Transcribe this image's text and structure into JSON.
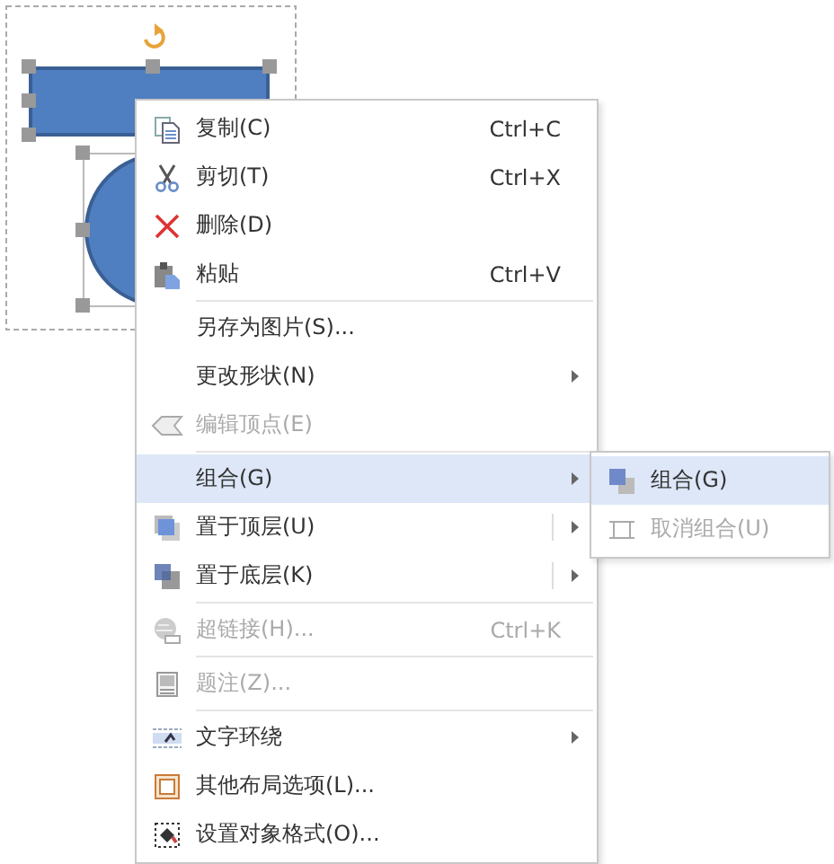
{
  "menu": {
    "items": [
      {
        "label": "复制(C)",
        "shortcut": "Ctrl+C",
        "disabled": false,
        "selected": false,
        "submenu": false,
        "split": false,
        "separator_before": false
      },
      {
        "label": "剪切(T)",
        "shortcut": "Ctrl+X",
        "disabled": false,
        "selected": false,
        "submenu": false,
        "split": false,
        "separator_before": false
      },
      {
        "label": "删除(D)",
        "disabled": false,
        "selected": false,
        "submenu": false,
        "split": false,
        "separator_before": false
      },
      {
        "label": "粘贴",
        "shortcut": "Ctrl+V",
        "disabled": false,
        "selected": false,
        "submenu": false,
        "split": false,
        "separator_before": false
      },
      {
        "label": "另存为图片(S)...",
        "disabled": false,
        "selected": false,
        "submenu": false,
        "split": false,
        "separator_before": true
      },
      {
        "label": "更改形状(N)",
        "disabled": false,
        "selected": false,
        "submenu": true,
        "split": false,
        "separator_before": false
      },
      {
        "label": "编辑顶点(E)",
        "disabled": true,
        "selected": false,
        "submenu": false,
        "split": false,
        "separator_before": false
      },
      {
        "label": "组合(G)",
        "disabled": false,
        "selected": true,
        "submenu": true,
        "split": false,
        "separator_before": true
      },
      {
        "label": "置于顶层(U)",
        "disabled": false,
        "selected": false,
        "submenu": true,
        "split": true,
        "separator_before": false
      },
      {
        "label": "置于底层(K)",
        "disabled": false,
        "selected": false,
        "submenu": true,
        "split": true,
        "separator_before": false
      },
      {
        "label": "超链接(H)...",
        "shortcut": "Ctrl+K",
        "disabled": true,
        "selected": false,
        "submenu": false,
        "split": false,
        "separator_before": true
      },
      {
        "label": "题注(Z)...",
        "disabled": true,
        "selected": false,
        "submenu": false,
        "split": false,
        "separator_before": true
      },
      {
        "label": "文字环绕",
        "disabled": false,
        "selected": false,
        "submenu": true,
        "split": false,
        "separator_before": true
      },
      {
        "label": "其他布局选项(L)...",
        "disabled": false,
        "selected": false,
        "submenu": false,
        "split": false,
        "separator_before": false
      },
      {
        "label": "设置对象格式(O)...",
        "disabled": false,
        "selected": false,
        "submenu": false,
        "split": false,
        "separator_before": false
      }
    ]
  },
  "submenu": {
    "items": [
      {
        "label": "组合(G)",
        "disabled": false,
        "selected": true
      },
      {
        "label": "取消组合(U)",
        "disabled": true,
        "selected": false
      }
    ]
  }
}
